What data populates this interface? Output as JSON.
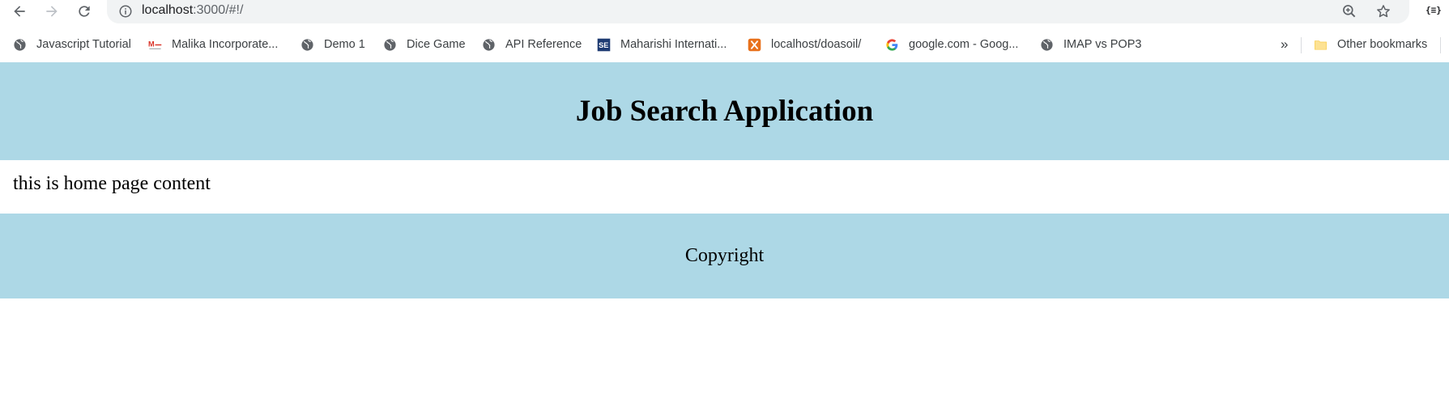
{
  "browser": {
    "url_host": "localhost",
    "url_path": ":3000/#!/",
    "extension_label": "{≡}"
  },
  "bookmarks": {
    "items": [
      {
        "label": "Javascript Tutorial",
        "icon": "globe-icon"
      },
      {
        "label": "Malika Incorporate...",
        "icon": "malika-logo-icon"
      },
      {
        "label": "Demo 1",
        "icon": "globe-icon"
      },
      {
        "label": "Dice Game",
        "icon": "globe-icon"
      },
      {
        "label": "API Reference",
        "icon": "globe-icon"
      },
      {
        "label": "Maharishi Internati...",
        "icon": "se-logo-icon"
      },
      {
        "label": "localhost/doasoil/",
        "icon": "xampp-icon"
      },
      {
        "label": "google.com - Goog...",
        "icon": "google-icon"
      },
      {
        "label": "IMAP vs POP3",
        "icon": "globe-icon"
      }
    ],
    "overflow_label": "»",
    "other_label": "Other bookmarks"
  },
  "page": {
    "title": "Job Search Application",
    "content": "this is home page content",
    "footer": "Copyright"
  },
  "colors": {
    "header_bg": "#add8e6",
    "footer_bg": "#add8e6",
    "omnibox_bg": "#f1f3f4"
  }
}
